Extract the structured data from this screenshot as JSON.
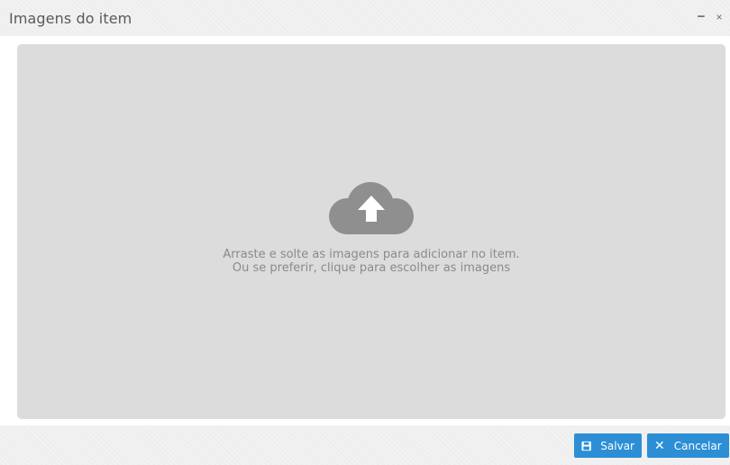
{
  "dialog": {
    "title": "Imagens do item",
    "minimize_glyph": "−",
    "close_glyph": "×"
  },
  "dropzone": {
    "icon": "cloud-upload-icon",
    "line1": "Arraste e solte as imagens para adicionar no item.",
    "line2": "Ou se preferir, clique para escolher as imagens"
  },
  "footer": {
    "save_label": "Salvar",
    "save_icon": "floppy-disk-icon",
    "cancel_label": "Cancelar",
    "cancel_icon": "close-icon",
    "cancel_glyph": "✕"
  },
  "colors": {
    "button": "#2c8fd6",
    "dropzone_bg": "#dcdcdc",
    "icon_gray": "#8f8f8f"
  }
}
